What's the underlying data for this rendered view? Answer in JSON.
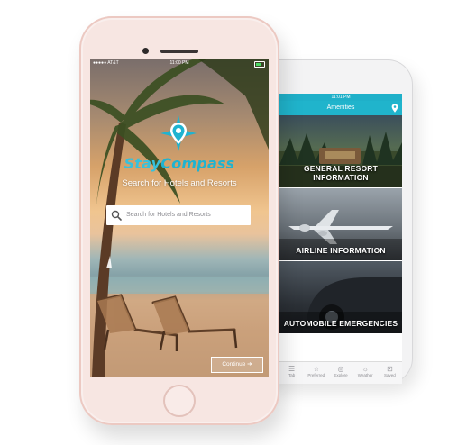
{
  "back_phone": {
    "status_time": "11:01 PM",
    "title": "Amenities",
    "cards": [
      {
        "label": "GENERAL RESORT INFORMATION"
      },
      {
        "label": "AIRLINE INFORMATION"
      },
      {
        "label": "AUTOMOBILE EMERGENCIES"
      }
    ],
    "tabs": [
      {
        "label": "Tab",
        "icon": "tab-icon"
      },
      {
        "label": "Preferred",
        "icon": "star-icon"
      },
      {
        "label": "Explore",
        "icon": "compass-icon"
      },
      {
        "label": "Weather",
        "icon": "sun-icon"
      },
      {
        "label": "Saved",
        "icon": "bookmark-icon"
      }
    ]
  },
  "front_phone": {
    "status": {
      "carrier": "●●●●● AT&T",
      "time": "11:00 PM"
    },
    "brand": {
      "stay": "Stay",
      "compass": "Compass"
    },
    "subtitle": "Search for Hotels and Resorts",
    "search": {
      "placeholder": "Search for Hotels and Resorts"
    },
    "continue_label": "Continue ➔"
  },
  "colors": {
    "accent": "#20b4cc",
    "rose_gold": "#f7e6e2"
  }
}
